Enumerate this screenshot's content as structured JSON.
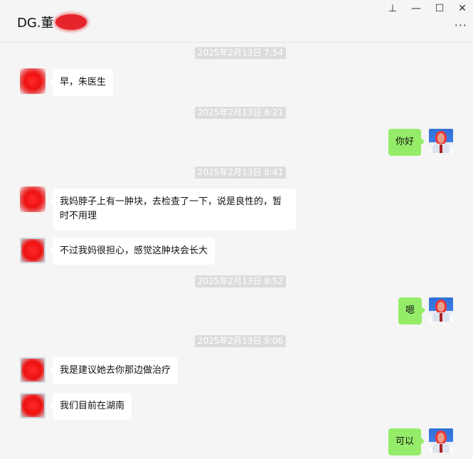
{
  "window": {
    "title": "DG.董",
    "pin_icon": "pin-icon",
    "minimize_icon": "minimize-icon",
    "maximize_icon": "maximize-icon",
    "close_icon": "close-icon",
    "more_icon": "more-icon",
    "pin_glyph": "⊥",
    "minimize_glyph": "—",
    "maximize_glyph": "☐",
    "close_glyph": "✕",
    "more_glyph": "···"
  },
  "colors": {
    "background": "#f5f5f5",
    "incoming_bubble": "#ffffff",
    "outgoing_bubble": "#95ec69",
    "timestamp_bg": "#dcdcdc",
    "redaction": "#e5252a"
  },
  "timestamps": [
    "2025年2月13日 7:54",
    "2025年2月13日 8:21",
    "2025年2月13日 8:41",
    "2025年2月13日 8:52",
    "2025年2月13日 9:06"
  ],
  "messages": [
    {
      "side": "left",
      "text": "早，朱医生"
    },
    {
      "side": "right",
      "text": "你好"
    },
    {
      "side": "left",
      "text": "我妈脖子上有一肿块，去检查了一下，说是良性的，暂时不用理"
    },
    {
      "side": "left",
      "text": "不过我妈很担心，感觉这肿块会长大"
    },
    {
      "side": "right",
      "text": "嗯"
    },
    {
      "side": "left",
      "text": "我是建议她去你那边做治疗"
    },
    {
      "side": "left",
      "text": "我们目前在湖南"
    },
    {
      "side": "right",
      "text": "可以"
    }
  ]
}
